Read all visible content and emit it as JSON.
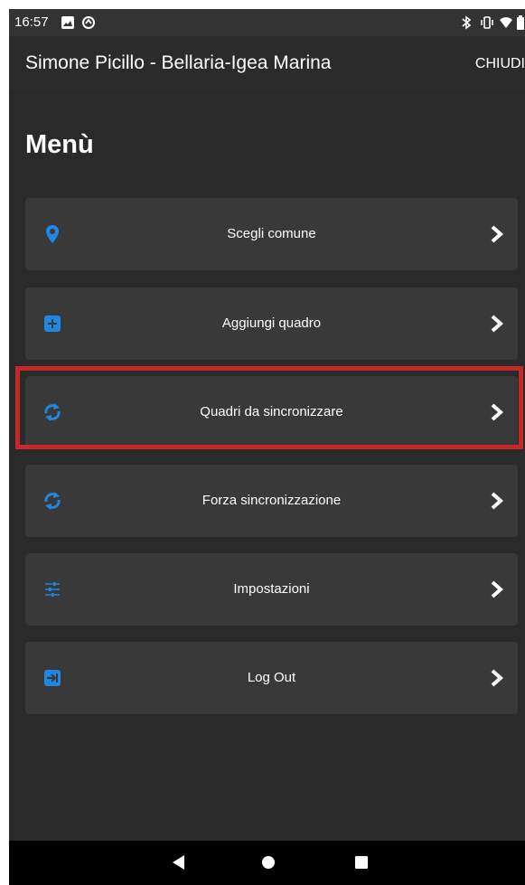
{
  "status_bar": {
    "time": "16:57"
  },
  "app_bar": {
    "title": "Simone Picillo - Bellaria-Igea Marina",
    "close_label": "CHIUDI"
  },
  "heading": "Menù",
  "colors": {
    "accent": "#1e88e5",
    "highlight": "#c62828",
    "card": "#393939",
    "background": "#2a2a2a"
  },
  "menu_items": [
    {
      "label": "Scegli comune",
      "icon": "location-pin-icon"
    },
    {
      "label": "Aggiungi quadro",
      "icon": "add-box-icon"
    },
    {
      "label": "Quadri da sincronizzare",
      "icon": "sync-icon"
    },
    {
      "label": "Forza sincronizzazione",
      "icon": "sync-icon"
    },
    {
      "label": "Impostazioni",
      "icon": "sliders-icon"
    },
    {
      "label": "Log Out",
      "icon": "logout-icon"
    }
  ],
  "nav_bar": {
    "icons": [
      "back-icon",
      "home-icon",
      "recents-icon"
    ]
  }
}
